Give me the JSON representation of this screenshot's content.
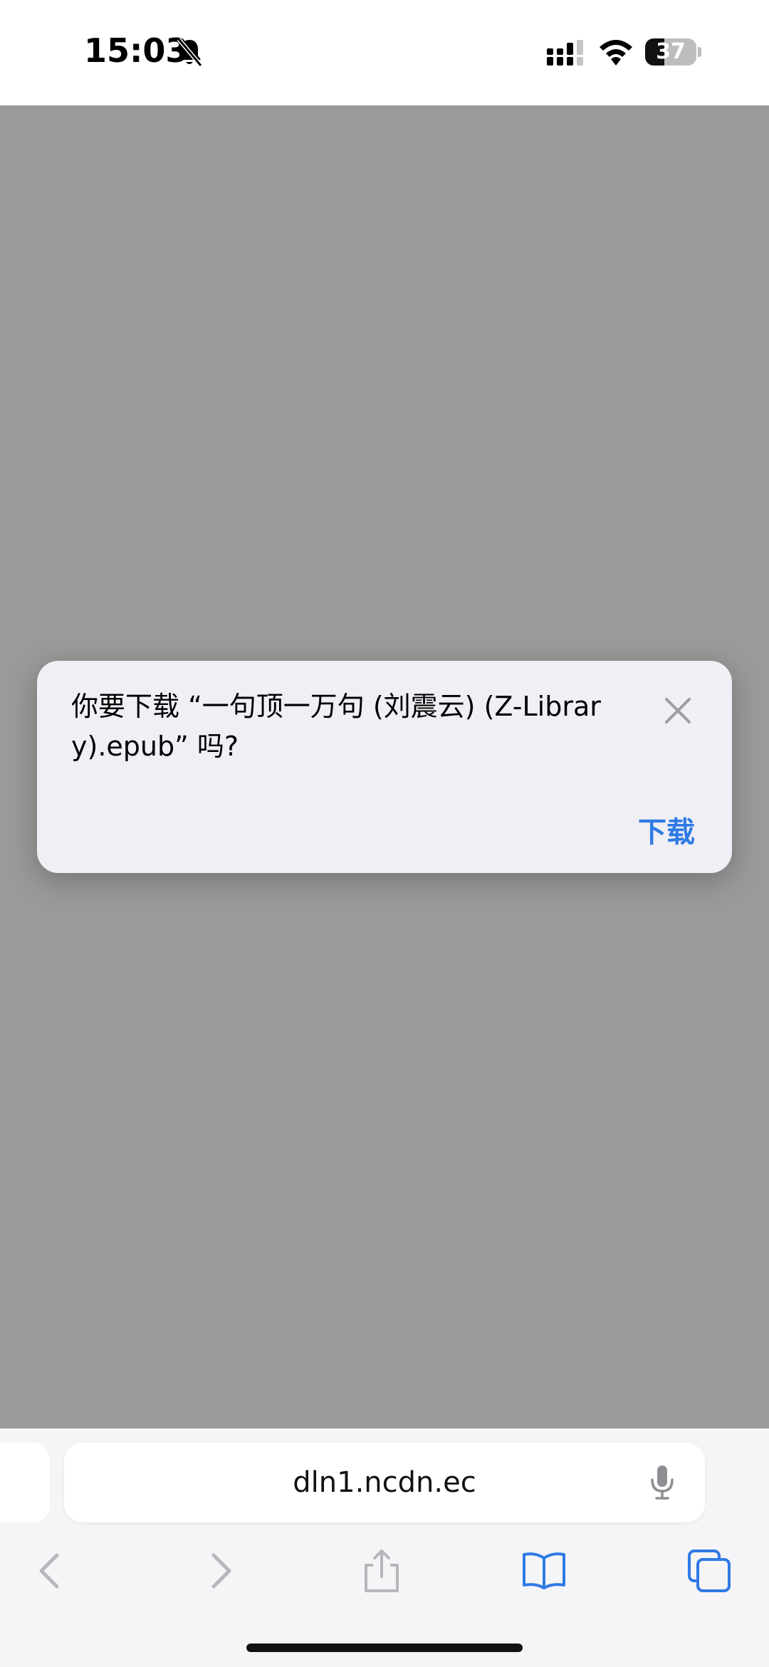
{
  "status_bar": {
    "time": "15:03",
    "battery_level": "37",
    "battery_fraction": 0.37
  },
  "dialog": {
    "message": "你要下载 “一句顶一万句 (刘震云) (Z-Library).epub” 吗?",
    "download_label": "下载"
  },
  "browser": {
    "address": "dln1.ncdn.ec"
  },
  "colors": {
    "accent": "#2f7ae5",
    "dim_overlay": "#9a9a9a",
    "dialog_bg": "#f0eff5"
  }
}
